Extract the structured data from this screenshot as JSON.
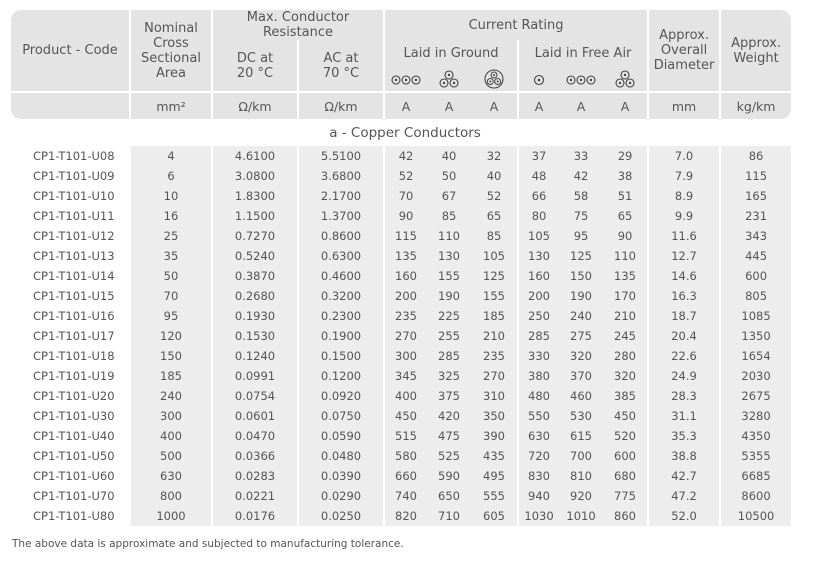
{
  "header": {
    "product_code": "Product - Code",
    "nominal_area": "Nominal\nCross\nSectional\nArea",
    "max_resistance": "Max. Conductor Resistance",
    "dc": "DC at\n20 °C",
    "ac": "AC at\n70 °C",
    "current_rating": "Current Rating",
    "laid_ground": "Laid in Ground",
    "laid_air": "Laid in Free Air",
    "diameter": "Approx.\nOverall\nDiameter",
    "weight": "Approx.\nWeight",
    "icons": [
      "trefoil-flat-icon",
      "trefoil-touching-icon",
      "trefoil-bundled-icon",
      "single-core-icon",
      "trefoil-flat-icon",
      "trefoil-touching-icon"
    ],
    "units": [
      "mm²",
      "Ω/km",
      "Ω/km",
      "A",
      "A",
      "A",
      "A",
      "A",
      "A",
      "mm",
      "kg/km"
    ]
  },
  "section_title": "a - Copper Conductors",
  "rows": [
    [
      "CP1-T101-U08",
      "4",
      "4.6100",
      "5.5100",
      "42",
      "40",
      "32",
      "37",
      "33",
      "29",
      "7.0",
      "86"
    ],
    [
      "CP1-T101-U09",
      "6",
      "3.0800",
      "3.6800",
      "52",
      "50",
      "40",
      "48",
      "42",
      "38",
      "7.9",
      "115"
    ],
    [
      "CP1-T101-U10",
      "10",
      "1.8300",
      "2.1700",
      "70",
      "67",
      "52",
      "66",
      "58",
      "51",
      "8.9",
      "165"
    ],
    [
      "CP1-T101-U11",
      "16",
      "1.1500",
      "1.3700",
      "90",
      "85",
      "65",
      "80",
      "75",
      "65",
      "9.9",
      "231"
    ],
    [
      "CP1-T101-U12",
      "25",
      "0.7270",
      "0.8600",
      "115",
      "110",
      "85",
      "105",
      "95",
      "90",
      "11.6",
      "343"
    ],
    [
      "CP1-T101-U13",
      "35",
      "0.5240",
      "0.6300",
      "135",
      "130",
      "105",
      "130",
      "125",
      "110",
      "12.7",
      "445"
    ],
    [
      "CP1-T101-U14",
      "50",
      "0.3870",
      "0.4600",
      "160",
      "155",
      "125",
      "160",
      "150",
      "135",
      "14.6",
      "600"
    ],
    [
      "CP1-T101-U15",
      "70",
      "0.2680",
      "0.3200",
      "200",
      "190",
      "155",
      "200",
      "190",
      "170",
      "16.3",
      "805"
    ],
    [
      "CP1-T101-U16",
      "95",
      "0.1930",
      "0.2300",
      "235",
      "225",
      "185",
      "250",
      "240",
      "210",
      "18.7",
      "1085"
    ],
    [
      "CP1-T101-U17",
      "120",
      "0.1530",
      "0.1900",
      "270",
      "255",
      "210",
      "285",
      "275",
      "245",
      "20.4",
      "1350"
    ],
    [
      "CP1-T101-U18",
      "150",
      "0.1240",
      "0.1500",
      "300",
      "285",
      "235",
      "330",
      "320",
      "280",
      "22.6",
      "1654"
    ],
    [
      "CP1-T101-U19",
      "185",
      "0.0991",
      "0.1200",
      "345",
      "325",
      "270",
      "380",
      "370",
      "320",
      "24.9",
      "2030"
    ],
    [
      "CP1-T101-U20",
      "240",
      "0.0754",
      "0.0920",
      "400",
      "375",
      "310",
      "480",
      "460",
      "385",
      "28.3",
      "2675"
    ],
    [
      "CP1-T101-U30",
      "300",
      "0.0601",
      "0.0750",
      "450",
      "420",
      "350",
      "550",
      "530",
      "450",
      "31.1",
      "3280"
    ],
    [
      "CP1-T101-U40",
      "400",
      "0.0470",
      "0.0590",
      "515",
      "475",
      "390",
      "630",
      "615",
      "520",
      "35.3",
      "4350"
    ],
    [
      "CP1-T101-U50",
      "500",
      "0.0366",
      "0.0480",
      "580",
      "525",
      "435",
      "720",
      "700",
      "600",
      "38.8",
      "5355"
    ],
    [
      "CP1-T101-U60",
      "630",
      "0.0283",
      "0.0390",
      "660",
      "590",
      "495",
      "830",
      "810",
      "680",
      "42.7",
      "6685"
    ],
    [
      "CP1-T101-U70",
      "800",
      "0.0221",
      "0.0290",
      "740",
      "650",
      "555",
      "940",
      "920",
      "775",
      "47.2",
      "8600"
    ],
    [
      "CP1-T101-U80",
      "1000",
      "0.0176",
      "0.0250",
      "820",
      "710",
      "605",
      "1030",
      "1010",
      "860",
      "52.0",
      "10500"
    ]
  ],
  "footnote": "The above data is approximate and subjected to manufacturing tolerance."
}
